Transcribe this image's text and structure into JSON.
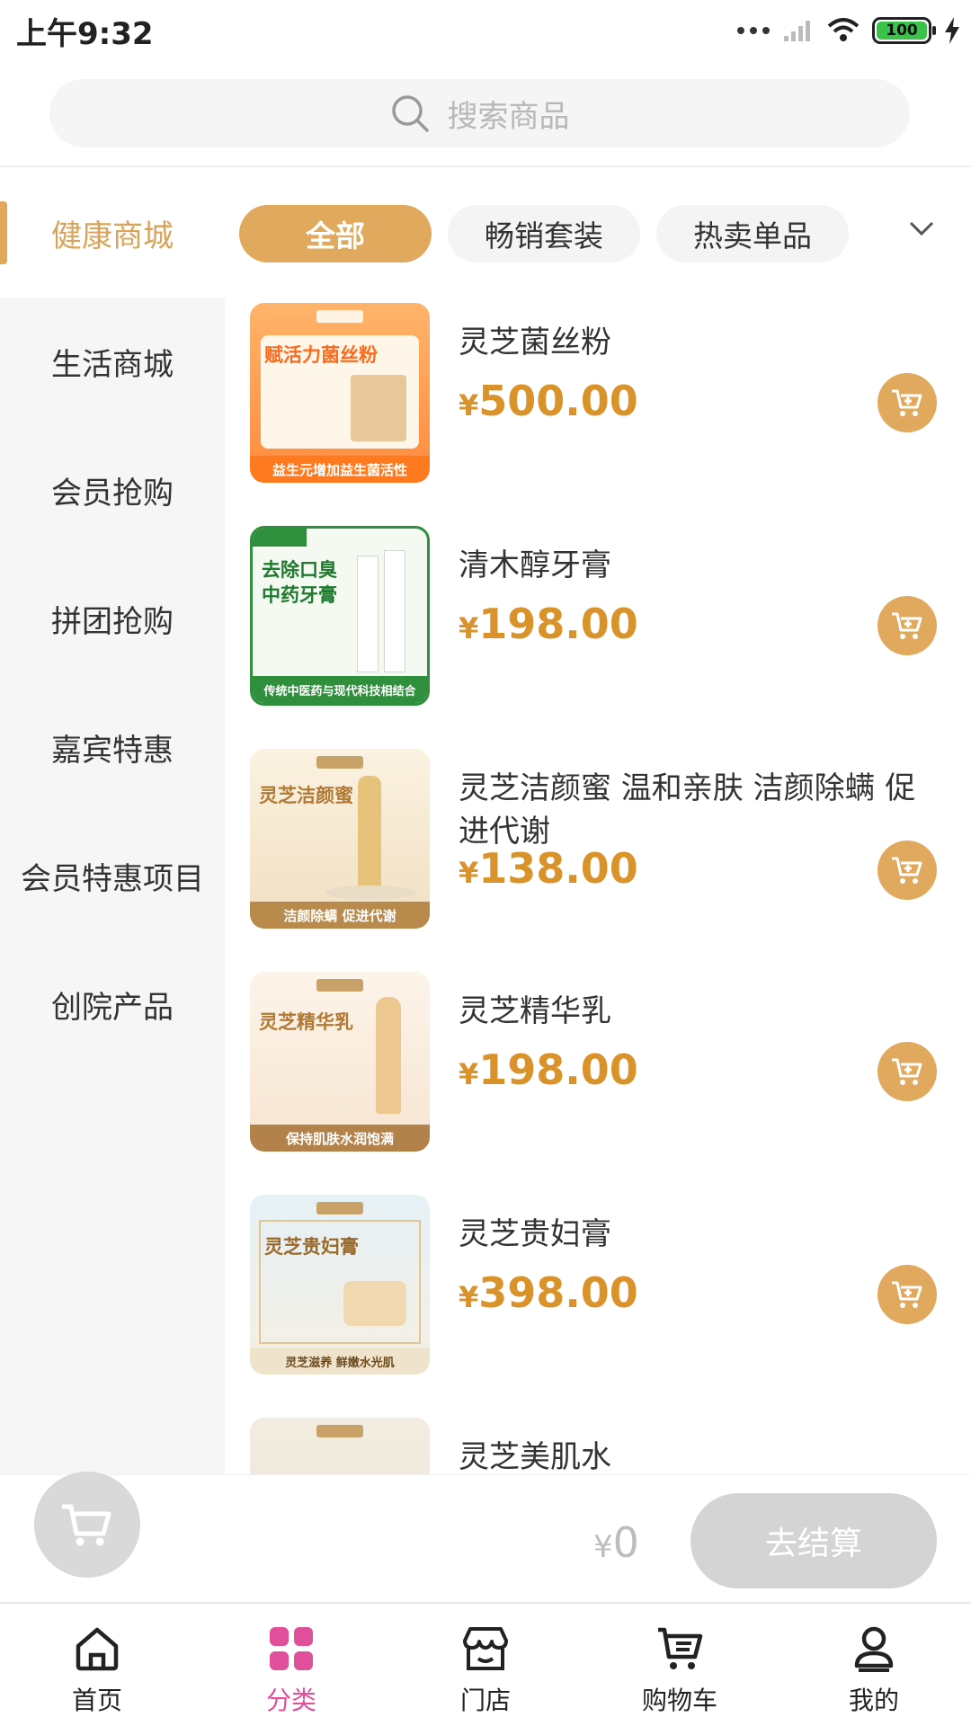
{
  "status_bar": {
    "time": "上午9:32",
    "battery": "100"
  },
  "search": {
    "placeholder": "搜索商品"
  },
  "sidebar": {
    "items": [
      {
        "label": "健康商城",
        "active": true
      },
      {
        "label": "生活商城",
        "active": false
      },
      {
        "label": "会员抢购",
        "active": false
      },
      {
        "label": "拼团抢购",
        "active": false
      },
      {
        "label": "嘉宾特惠",
        "active": false
      },
      {
        "label": "会员特惠项目",
        "active": false
      },
      {
        "label": "创院产品",
        "active": false
      }
    ]
  },
  "tabs": [
    {
      "label": "全部",
      "active": true
    },
    {
      "label": "畅销套装",
      "active": false
    },
    {
      "label": "热卖单品",
      "active": false
    }
  ],
  "products": [
    {
      "name": "灵芝菌丝粉",
      "currency": "¥",
      "price": "500.00",
      "thumb_title": "赋活力菌丝粉",
      "thumb_caption": "益生元增加益生菌活性"
    },
    {
      "name": "清木醇牙膏",
      "currency": "¥",
      "price": "198.00",
      "thumb_title": "去除口臭 中药牙膏",
      "thumb_caption": "传统中医药与现代科技相结合"
    },
    {
      "name": "灵芝洁颜蜜 温和亲肤 洁颜除螨 促进代谢",
      "currency": "¥",
      "price": "138.00",
      "thumb_title": "灵芝洁颜蜜",
      "thumb_caption": "洁颜除螨 促进代谢"
    },
    {
      "name": "灵芝精华乳",
      "currency": "¥",
      "price": "198.00",
      "thumb_title": "灵芝精华乳",
      "thumb_caption": "保持肌肤水润饱满"
    },
    {
      "name": "灵芝贵妇膏",
      "currency": "¥",
      "price": "398.00",
      "thumb_title": "灵芝贵妇膏",
      "thumb_caption": "灵芝滋养 鲜嫩水光肌"
    },
    {
      "name": "灵芝美肌水",
      "currency": "¥",
      "price": "",
      "thumb_title": "",
      "thumb_caption": ""
    }
  ],
  "checkout": {
    "currency": "¥",
    "total": "0",
    "button_label": "去结算"
  },
  "bottom_nav": [
    {
      "label": "首页",
      "icon": "home-icon",
      "active": false
    },
    {
      "label": "分类",
      "icon": "category-icon",
      "active": true
    },
    {
      "label": "门店",
      "icon": "store-icon",
      "active": false
    },
    {
      "label": "购物车",
      "icon": "cart-icon",
      "active": false
    },
    {
      "label": "我的",
      "icon": "profile-icon",
      "active": false
    }
  ],
  "colors": {
    "accent": "#e0a95e",
    "price": "#d9932a",
    "nav_active": "#e04f9a"
  }
}
